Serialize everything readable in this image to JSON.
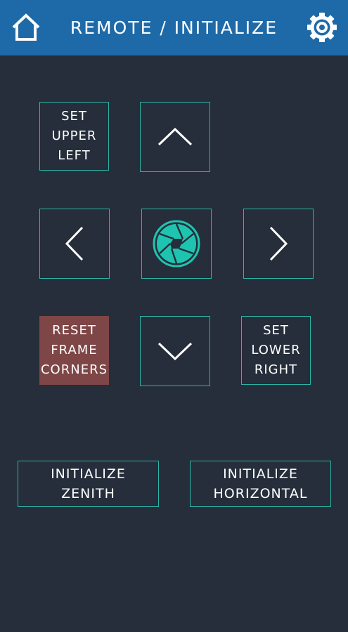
{
  "header": {
    "title": "REMOTE / INITIALIZE",
    "home_icon": "home-icon",
    "settings_icon": "gear-icon",
    "background": "#1e6aa8"
  },
  "controls": {
    "set_upper_left": [
      "SET",
      "UPPER",
      "LEFT"
    ],
    "up_icon": "chevron-up-icon",
    "left_icon": "chevron-left-icon",
    "shutter_icon": "camera-shutter-icon",
    "right_icon": "chevron-right-icon",
    "reset_frame_corners": [
      "RESET",
      "FRAME",
      "CORNERS"
    ],
    "down_icon": "chevron-down-icon",
    "set_lower_right": [
      "SET",
      "LOWER",
      "RIGHT"
    ]
  },
  "actions": {
    "initialize_zenith": [
      "INITIALIZE",
      "ZENITH"
    ],
    "initialize_horizontal": [
      "INITIALIZE",
      "HORIZONTAL"
    ]
  },
  "colors": {
    "background": "#252e3a",
    "accent": "#2bb5a6",
    "shutter": "#1fc4b0",
    "reset": "#7e4646"
  }
}
